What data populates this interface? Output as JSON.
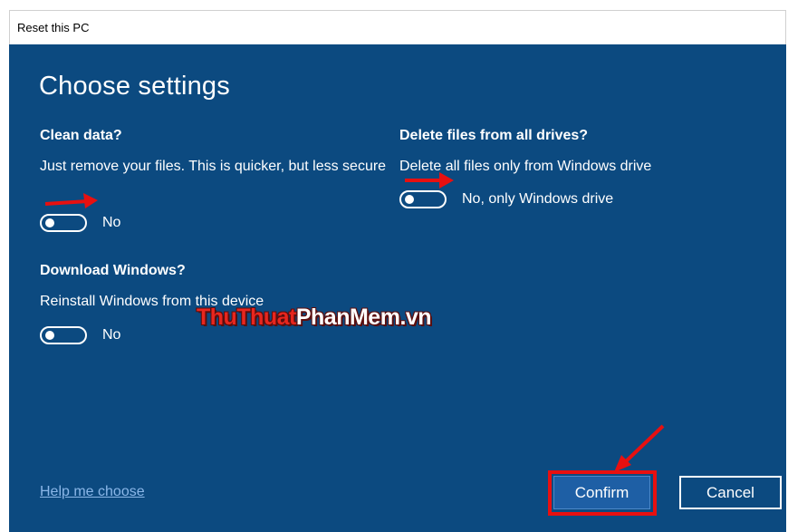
{
  "window": {
    "title": "Reset this PC"
  },
  "dialog": {
    "heading": "Choose settings",
    "clean_data": {
      "title": "Clean data?",
      "description": "Just remove your files. This is quicker, but less secure",
      "toggle_state": "No"
    },
    "delete_drives": {
      "title": "Delete files from all drives?",
      "description": "Delete all files only from Windows drive",
      "toggle_state": "No, only Windows drive"
    },
    "download_windows": {
      "title": "Download Windows?",
      "description": "Reinstall Windows from this device",
      "toggle_state": "No"
    },
    "help_link": "Help me choose",
    "buttons": {
      "confirm": "Confirm",
      "cancel": "Cancel"
    }
  },
  "watermark": {
    "part1": "ThuThuat",
    "part2": "PhanMem",
    "part3": ".vn"
  },
  "colors": {
    "dialog_bg": "#0c4a80",
    "confirm_bg": "#1e5fa5",
    "link": "#8bb7e8",
    "annotation_red": "#e81010"
  }
}
